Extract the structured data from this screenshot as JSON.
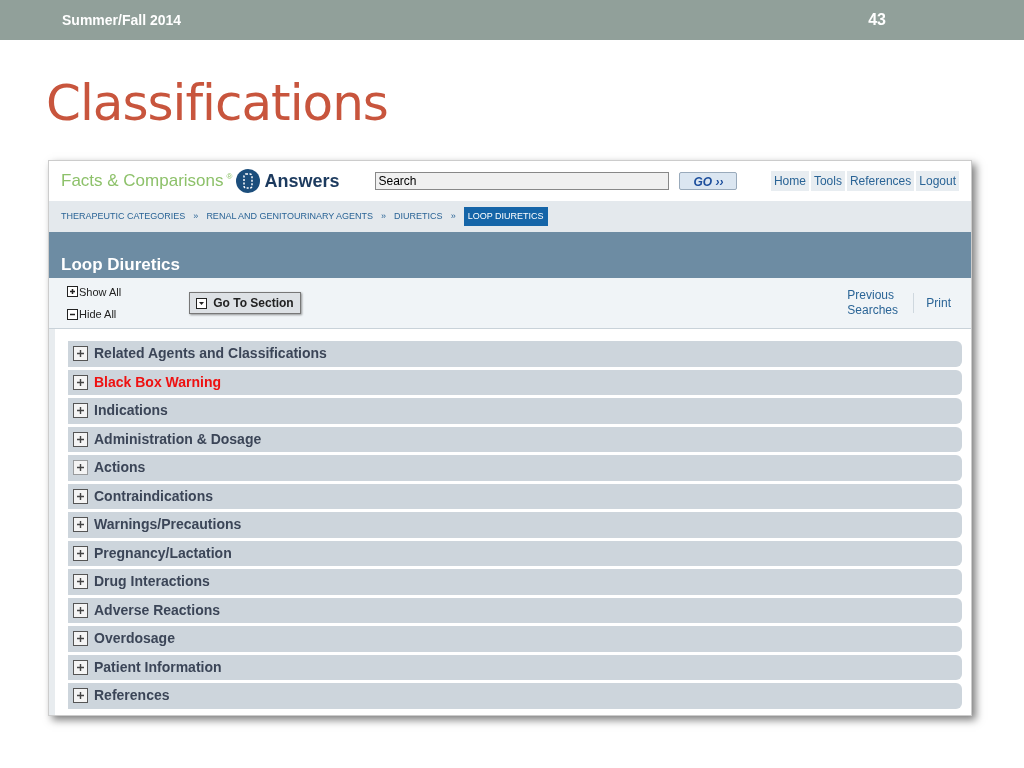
{
  "slide": {
    "footer_left": "Summer/Fall 2014",
    "page_number": "43",
    "title": "Classifications"
  },
  "site": {
    "logo_text": "Facts & Comparisons",
    "logo_mark": "®",
    "logo_product": "Answers",
    "search": {
      "value": "Search"
    },
    "go_button": "GO ››",
    "nav": [
      "Home",
      "Tools",
      "References",
      "Logout"
    ],
    "breadcrumbs": [
      {
        "label": "THERAPEUTIC CATEGORIES",
        "selected": false
      },
      {
        "label": "RENAL AND GENITOURINARY AGENTS",
        "selected": false
      },
      {
        "label": "DIURETICS",
        "selected": false
      },
      {
        "label": "LOOP DIURETICS",
        "selected": true
      }
    ],
    "breadcrumb_separator": "»",
    "page_title": "Loop Diuretics",
    "show_all": "Show All",
    "hide_all": "Hide All",
    "go_to_section": "Go To Section",
    "previous_searches": "Previous Searches",
    "print": "Print",
    "sections": [
      {
        "label": "Related Agents and Classifications",
        "kind": "normal",
        "focused": false
      },
      {
        "label": "Black Box Warning",
        "kind": "warning",
        "focused": false
      },
      {
        "label": "Indications",
        "kind": "normal",
        "focused": false
      },
      {
        "label": "Administration & Dosage",
        "kind": "normal",
        "focused": false
      },
      {
        "label": "Actions",
        "kind": "normal",
        "focused": true
      },
      {
        "label": "Contraindications",
        "kind": "normal",
        "focused": false
      },
      {
        "label": "Warnings/Precautions",
        "kind": "normal",
        "focused": false
      },
      {
        "label": "Pregnancy/Lactation",
        "kind": "normal",
        "focused": false
      },
      {
        "label": "Drug Interactions",
        "kind": "normal",
        "focused": false
      },
      {
        "label": "Adverse Reactions",
        "kind": "normal",
        "focused": false
      },
      {
        "label": "Overdosage",
        "kind": "normal",
        "focused": false
      },
      {
        "label": "Patient Information",
        "kind": "normal",
        "focused": false
      },
      {
        "label": "References",
        "kind": "normal",
        "focused": false
      }
    ]
  }
}
